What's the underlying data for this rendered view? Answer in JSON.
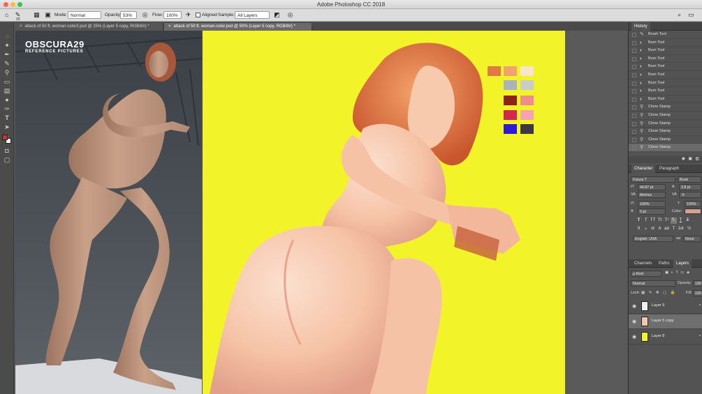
{
  "window": {
    "title": "Adobe Photoshop CC 2018"
  },
  "options_bar": {
    "brush_size": "25",
    "mode_label": "Mode:",
    "mode_value": "Normal",
    "opacity_label": "Opacity:",
    "opacity_value": "53%",
    "flow_label": "Flow:",
    "flow_value": "100%",
    "aligned_label": "Aligned",
    "sample_label": "Sample:",
    "sample_value": "All Layers"
  },
  "tabs": [
    {
      "label": "attack of 50 ft. woman-color2.psd @ 25% (Layer 5 copy, RGB/8#) *"
    },
    {
      "label": "attack of 50 ft. woman-color.psd @ 50% (Layer 5 copy, RGB/8#) *"
    }
  ],
  "reference": {
    "logo_line1": "OBSCURA29",
    "logo_line2": "REFERENCE PICTURES"
  },
  "swatches": [
    "#e07a45",
    "#f0a36e",
    "#f7e6cc",
    "#a7b4bc",
    "#c9cdc7",
    "#8e2313",
    "#f18c8c",
    "#d8254f",
    "#f6a2b2",
    "#2d19d6",
    "#3d3843"
  ],
  "colors": {
    "foreground": "#c0392b",
    "background": "#ffffff",
    "canvas_bg": "#f2f429",
    "text_color": "#d8a090"
  },
  "history": {
    "title": "History",
    "items": [
      {
        "icon": "brush-icon",
        "label": "Brush Tool"
      },
      {
        "icon": "burn-icon",
        "label": "Burn Tool"
      },
      {
        "icon": "burn-icon",
        "label": "Burn Tool"
      },
      {
        "icon": "burn-icon",
        "label": "Burn Tool"
      },
      {
        "icon": "burn-icon",
        "label": "Burn Tool"
      },
      {
        "icon": "burn-icon",
        "label": "Burn Tool"
      },
      {
        "icon": "burn-icon",
        "label": "Burn Tool"
      },
      {
        "icon": "burn-icon",
        "label": "Burn Tool"
      },
      {
        "icon": "burn-icon",
        "label": "Burn Tool"
      },
      {
        "icon": "stamp-icon",
        "label": "Clone Stamp"
      },
      {
        "icon": "stamp-icon",
        "label": "Clone Stamp"
      },
      {
        "icon": "stamp-icon",
        "label": "Clone Stamp"
      },
      {
        "icon": "stamp-icon",
        "label": "Clone Stamp"
      },
      {
        "icon": "stamp-icon",
        "label": "Clone Stamp"
      },
      {
        "icon": "stamp-icon",
        "label": "Clone Stamp"
      }
    ]
  },
  "character": {
    "tab_character": "Character",
    "tab_paragraph": "Paragraph",
    "font_family": "Futura T",
    "font_style": "Book",
    "size": "44.87 pt",
    "leading": "3.8 pt",
    "kerning": "Metrics",
    "tracking": "-5",
    "vscale": "100%",
    "hscale": "100%",
    "baseline": "0 pt",
    "color_label": "Color:",
    "language": "English: USA",
    "antialias": "None"
  },
  "layers": {
    "tab_channels": "Channels",
    "tab_paths": "Paths",
    "tab_layers": "Layers",
    "filter": "Kind",
    "blend": "Normal",
    "opacity_label": "Opacity:",
    "opacity_value": "100",
    "lock_label": "Lock:",
    "fill_label": "Fill:",
    "fill_value": "100",
    "items": [
      {
        "name": "Layer 9",
        "thumb": "#eeeeee",
        "selected": false
      },
      {
        "name": "Layer 5 copy",
        "thumb": "#f3c7b0",
        "selected": true
      },
      {
        "name": "Layer 8",
        "thumb": "#f2f429",
        "selected": false
      }
    ]
  }
}
